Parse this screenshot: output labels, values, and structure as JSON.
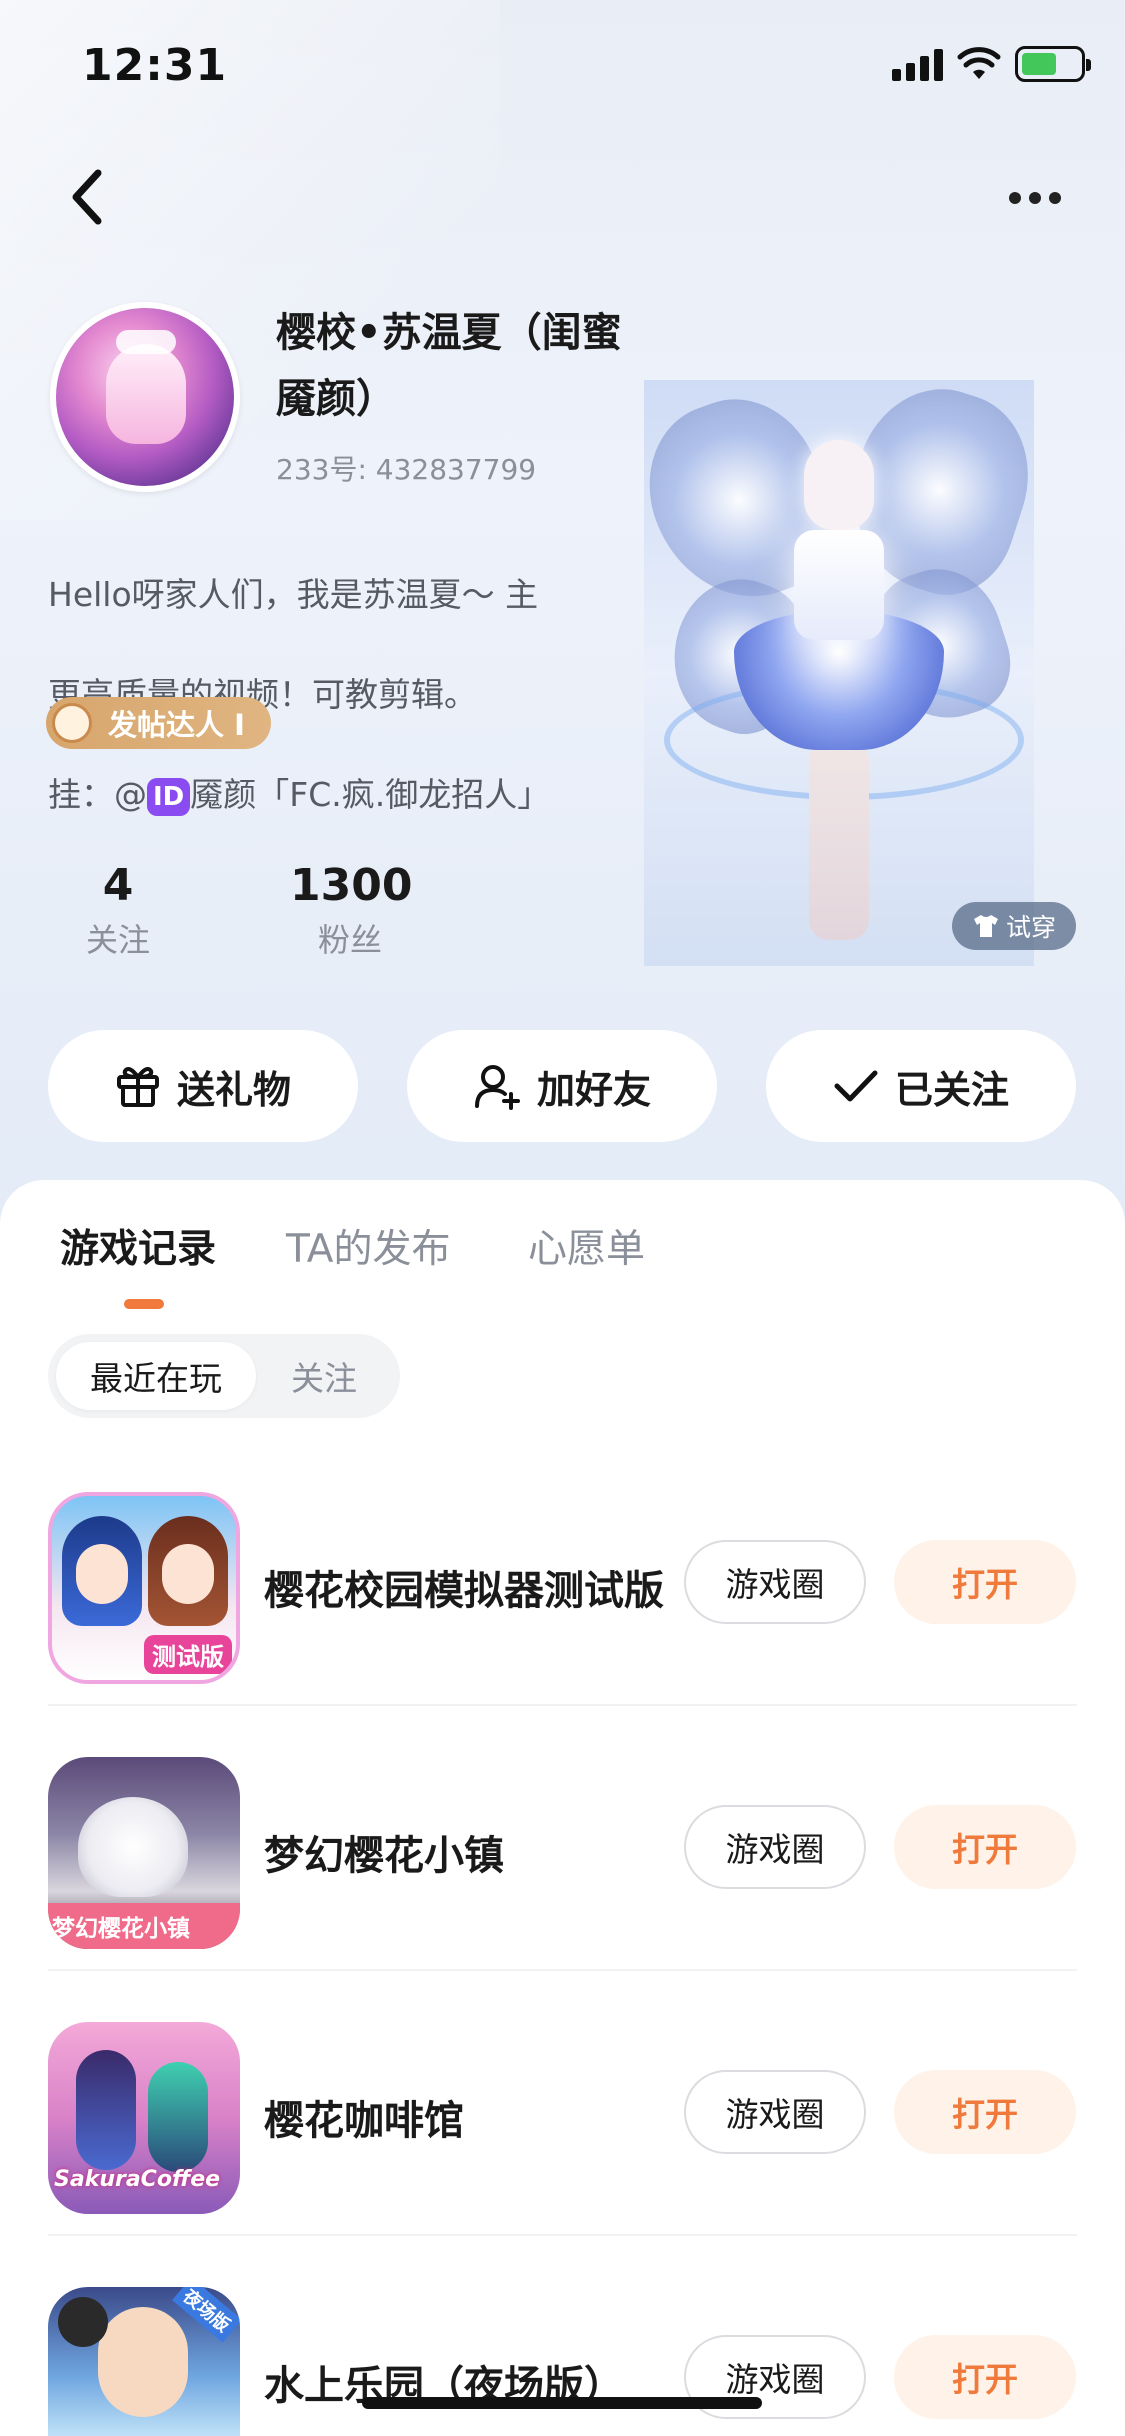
{
  "status_bar": {
    "time": "12:31"
  },
  "profile": {
    "name": "樱校•苏温夏（闺蜜魇颜）",
    "id_text": "233号: 432837799",
    "bio_line1": "Hello呀家人们，我是苏温夏～ 主",
    "bio_line2": "更高质量的视频！可教剪辑。",
    "bio_line3_prefix": "挂：@",
    "bio_id_badge": "ID",
    "bio_line3_suffix": "魇颜「FC.疯.御龙招人」",
    "achievement": "发帖达人 I",
    "following_count": "4",
    "following_label": "关注",
    "followers_count": "1300",
    "followers_label": "粉丝",
    "try_on_label": "试穿"
  },
  "actions": {
    "gift_label": "送礼物",
    "add_friend_label": "加好友",
    "followed_label": "已关注"
  },
  "tabs": [
    {
      "label": "游戏记录"
    },
    {
      "label": "TA的发布"
    },
    {
      "label": "心愿单"
    }
  ],
  "segments": {
    "recent": "最近在玩",
    "follow": "关注"
  },
  "games": [
    {
      "title": "樱花校园模拟器测试版",
      "circle_label": "游戏圈",
      "open_label": "打开",
      "icon_text": "测试版"
    },
    {
      "title": "梦幻樱花小镇",
      "circle_label": "游戏圈",
      "open_label": "打开",
      "icon_text": "梦幻樱花小镇"
    },
    {
      "title": "樱花咖啡馆",
      "circle_label": "游戏圈",
      "open_label": "打开",
      "icon_text": "SakuraCoffee"
    },
    {
      "title": "水上乐园（夜场版）",
      "circle_label": "游戏圈",
      "open_label": "打开",
      "icon_text": "夜场版"
    }
  ],
  "colors": {
    "accent_orange": "#f07a3b",
    "open_bg": "#fef2e9",
    "achievement_gold": "#d7a66d",
    "id_purple": "#8a4cf0"
  }
}
